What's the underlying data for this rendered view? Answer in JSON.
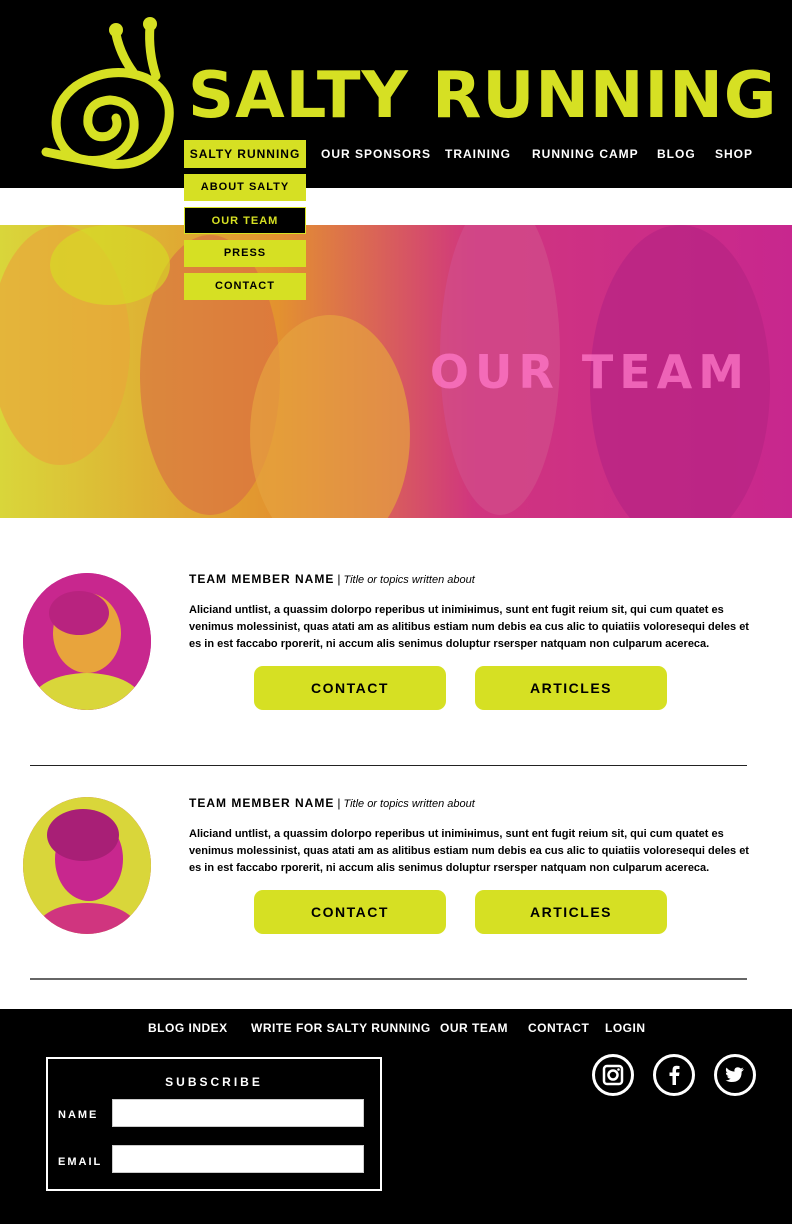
{
  "brand": {
    "name": "SALTY RUNNING"
  },
  "colors": {
    "accent": "#d6e023",
    "magenta": "#c8278e",
    "black": "#000000",
    "white": "#ffffff"
  },
  "nav": {
    "items": [
      "SALTY RUNNING",
      "OUR SPONSORS",
      "TRAINING",
      "RUNNING CAMP",
      "BLOG",
      "SHOP"
    ],
    "dropdown": [
      "ABOUT SALTY",
      "OUR TEAM",
      "PRESS",
      "CONTACT"
    ]
  },
  "hero": {
    "title": "OUR TEAM"
  },
  "members": [
    {
      "name": "TEAM MEMBER NAME",
      "separator": "|",
      "title": "Title or topics written about",
      "bio": "Aliciand untlist, a quassim dolorpo reperibus ut inimінimus, sunt ent fugit reium sit, qui cum quatet es venimus molessinist, quas atati am as alitibus estiam num debis ea cus alic to quiatiis voloresequi deles et es in est faccabo rporerit, ni accum alis senimus doluptur rsersper natquam non culparum acereca.",
      "contact_label": "CONTACT",
      "articles_label": "ARTICLES"
    },
    {
      "name": "TEAM MEMBER NAME",
      "separator": "|",
      "title": "Title or topics written about",
      "bio": "Aliciand untlist, a quassim dolorpo reperibus ut inimінimus, sunt ent fugit reium sit, qui cum quatet es venimus molessinist, quas atati am as alitibus estiam num debis ea cus alic to quiatiis voloresequi deles et es in est faccabo rporerit, ni accum alis senimus doluptur rsersper natquam non culparum acereca.",
      "contact_label": "CONTACT",
      "articles_label": "ARTICLES"
    }
  ],
  "footer": {
    "links": [
      "BLOG INDEX",
      "WRITE FOR SALTY RUNNING",
      "OUR TEAM",
      "CONTACT",
      "LOGIN"
    ],
    "subscribe": {
      "title": "SUBSCRIBE",
      "name_label": "NAME",
      "email_label": "EMAIL"
    },
    "social": [
      "instagram-icon",
      "facebook-icon",
      "twitter-icon"
    ]
  }
}
